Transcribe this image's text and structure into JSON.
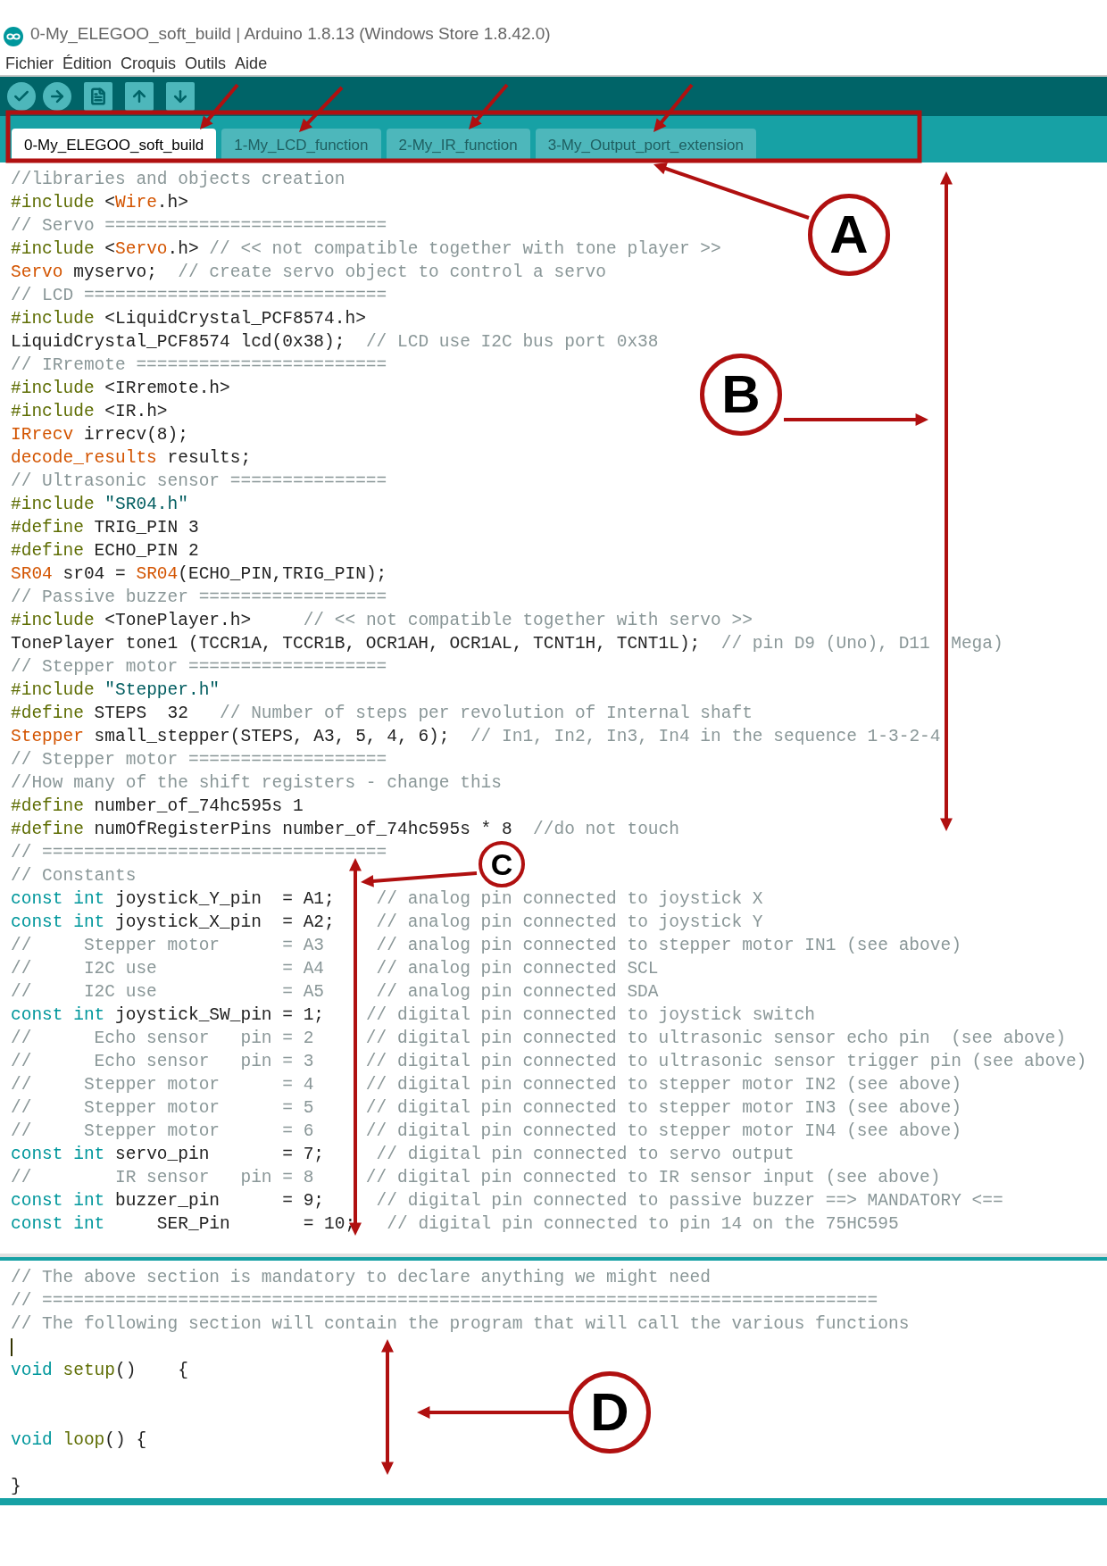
{
  "window": {
    "title": "0-My_ELEGOO_soft_build | Arduino 1.8.13 (Windows Store 1.8.42.0)"
  },
  "menu": [
    "Fichier",
    "Édition",
    "Croquis",
    "Outils",
    "Aide"
  ],
  "toolbar": [
    {
      "kind": "verify"
    },
    {
      "kind": "upload"
    },
    {
      "kind": "new"
    },
    {
      "kind": "open"
    },
    {
      "kind": "save"
    }
  ],
  "tabs": [
    {
      "label": "0-My_ELEGOO_soft_build",
      "selected": true
    },
    {
      "label": "1-My_LCD_function",
      "selected": false
    },
    {
      "label": "2-My_IR_function",
      "selected": false
    },
    {
      "label": "3-My_Output_port_extension",
      "selected": false
    }
  ],
  "editor": {
    "upper_lines": [
      {
        "segments": [
          {
            "kind": "comment",
            "text": "//libraries and objects creation"
          }
        ]
      },
      {
        "segments": [
          {
            "kind": "directive",
            "text": "#include"
          },
          {
            "kind": "plain",
            "text": " <"
          },
          {
            "kind": "type",
            "text": "Wire"
          },
          {
            "kind": "plain",
            "text": ".h>"
          }
        ]
      },
      {
        "segments": [
          {
            "kind": "comment",
            "text": "// Servo ==========================="
          }
        ]
      },
      {
        "segments": [
          {
            "kind": "directive",
            "text": "#include"
          },
          {
            "kind": "plain",
            "text": " <"
          },
          {
            "kind": "type",
            "text": "Servo"
          },
          {
            "kind": "plain",
            "text": ".h> "
          },
          {
            "kind": "comment",
            "text": "// << not compatible together with tone player >>"
          }
        ]
      },
      {
        "segments": [
          {
            "kind": "type",
            "text": "Servo"
          },
          {
            "kind": "plain",
            "text": " myservo;  "
          },
          {
            "kind": "comment",
            "text": "// create servo object to control a servo"
          }
        ]
      },
      {
        "segments": [
          {
            "kind": "comment",
            "text": "// LCD ============================="
          }
        ]
      },
      {
        "segments": [
          {
            "kind": "directive",
            "text": "#include"
          },
          {
            "kind": "plain",
            "text": " <LiquidCrystal_PCF8574.h>"
          }
        ]
      },
      {
        "segments": [
          {
            "kind": "plain",
            "text": "LiquidCrystal_PCF8574 lcd(0x38);  "
          },
          {
            "kind": "comment",
            "text": "// LCD use I2C bus port 0x38"
          }
        ]
      },
      {
        "segments": [
          {
            "kind": "comment",
            "text": "// IRremote ========================"
          }
        ]
      },
      {
        "segments": [
          {
            "kind": "directive",
            "text": "#include"
          },
          {
            "kind": "plain",
            "text": " <IRremote.h>"
          }
        ]
      },
      {
        "segments": [
          {
            "kind": "directive",
            "text": "#include"
          },
          {
            "kind": "plain",
            "text": " <IR.h>"
          }
        ]
      },
      {
        "segments": [
          {
            "kind": "type",
            "text": "IRrecv"
          },
          {
            "kind": "plain",
            "text": " irrecv(8);"
          }
        ]
      },
      {
        "segments": [
          {
            "kind": "type",
            "text": "decode_results"
          },
          {
            "kind": "plain",
            "text": " results;"
          }
        ]
      },
      {
        "segments": [
          {
            "kind": "comment",
            "text": "// Ultrasonic sensor ==============="
          }
        ]
      },
      {
        "segments": [
          {
            "kind": "directive",
            "text": "#include "
          },
          {
            "kind": "string",
            "text": "\"SR04.h\""
          }
        ]
      },
      {
        "segments": [
          {
            "kind": "directive",
            "text": "#define"
          },
          {
            "kind": "plain",
            "text": " TRIG_PIN 3"
          }
        ]
      },
      {
        "segments": [
          {
            "kind": "directive",
            "text": "#define"
          },
          {
            "kind": "plain",
            "text": " ECHO_PIN 2"
          }
        ]
      },
      {
        "segments": [
          {
            "kind": "type",
            "text": "SR04"
          },
          {
            "kind": "plain",
            "text": " sr04 = "
          },
          {
            "kind": "type",
            "text": "SR04"
          },
          {
            "kind": "plain",
            "text": "(ECHO_PIN,TRIG_PIN);"
          }
        ]
      },
      {
        "segments": [
          {
            "kind": "comment",
            "text": "// Passive buzzer =================="
          }
        ]
      },
      {
        "segments": [
          {
            "kind": "directive",
            "text": "#include"
          },
          {
            "kind": "plain",
            "text": " <TonePlayer.h>     "
          },
          {
            "kind": "comment",
            "text": "// << not compatible together with servo >>"
          }
        ]
      },
      {
        "segments": [
          {
            "kind": "plain",
            "text": "TonePlayer tone1 (TCCR1A, TCCR1B, OCR1AH, OCR1AL, TCNT1H, TCNT1L);  "
          },
          {
            "kind": "comment",
            "text": "// pin D9 (Uno), D11  Mega)"
          }
        ]
      },
      {
        "segments": [
          {
            "kind": "comment",
            "text": "// Stepper motor ==================="
          }
        ]
      },
      {
        "segments": [
          {
            "kind": "directive",
            "text": "#include "
          },
          {
            "kind": "string",
            "text": "\"Stepper.h\""
          }
        ]
      },
      {
        "segments": [
          {
            "kind": "directive",
            "text": "#define"
          },
          {
            "kind": "plain",
            "text": " STEPS  32   "
          },
          {
            "kind": "comment",
            "text": "// Number of steps per revolution of Internal shaft"
          }
        ]
      },
      {
        "segments": [
          {
            "kind": "type",
            "text": "Stepper"
          },
          {
            "kind": "plain",
            "text": " small_stepper(STEPS, A3, 5, 4, 6);  "
          },
          {
            "kind": "comment",
            "text": "// In1, In2, In3, In4 in the sequence 1-3-2-4"
          }
        ]
      },
      {
        "segments": [
          {
            "kind": "comment",
            "text": "// Stepper motor ==================="
          }
        ]
      },
      {
        "segments": [
          {
            "kind": "comment",
            "text": "//How many of the shift registers - change this"
          }
        ]
      },
      {
        "segments": [
          {
            "kind": "directive",
            "text": "#define"
          },
          {
            "kind": "plain",
            "text": " number_of_74hc595s 1"
          }
        ]
      },
      {
        "segments": [
          {
            "kind": "directive",
            "text": "#define"
          },
          {
            "kind": "plain",
            "text": " numOfRegisterPins number_of_74hc595s * 8  "
          },
          {
            "kind": "comment",
            "text": "//do not touch"
          }
        ]
      },
      {
        "segments": [
          {
            "kind": "comment",
            "text": "// ================================="
          }
        ]
      },
      {
        "segments": [
          {
            "kind": "comment",
            "text": "// Constants"
          }
        ]
      },
      {
        "segments": [
          {
            "kind": "keyword",
            "text": "const int"
          },
          {
            "kind": "plain",
            "text": " joystick_Y_pin  = A1;    "
          },
          {
            "kind": "comment",
            "text": "// analog pin connected to joystick X"
          }
        ]
      },
      {
        "segments": [
          {
            "kind": "keyword",
            "text": "const int"
          },
          {
            "kind": "plain",
            "text": " joystick_X_pin  = A2;    "
          },
          {
            "kind": "comment",
            "text": "// analog pin connected to joystick Y"
          }
        ]
      },
      {
        "segments": [
          {
            "kind": "comment",
            "text": "//     Stepper motor      = A3     // analog pin connected to stepper motor IN1 (see above)"
          }
        ]
      },
      {
        "segments": [
          {
            "kind": "comment",
            "text": "//     I2C use            = A4     // analog pin connected SCL"
          }
        ]
      },
      {
        "segments": [
          {
            "kind": "comment",
            "text": "//     I2C use            = A5     // analog pin connected SDA"
          }
        ]
      },
      {
        "segments": [
          {
            "kind": "keyword",
            "text": "const int"
          },
          {
            "kind": "plain",
            "text": " joystick_SW_pin = 1;    "
          },
          {
            "kind": "comment",
            "text": "// digital pin connected to joystick switch"
          }
        ]
      },
      {
        "segments": [
          {
            "kind": "comment",
            "text": "//      Echo sensor   pin = 2     // digital pin connected to ultrasonic sensor echo pin  (see above)"
          }
        ]
      },
      {
        "segments": [
          {
            "kind": "comment",
            "text": "//      Echo sensor   pin = 3     // digital pin connected to ultrasonic sensor trigger pin (see above)"
          }
        ]
      },
      {
        "segments": [
          {
            "kind": "comment",
            "text": "//     Stepper motor      = 4     // digital pin connected to stepper motor IN2 (see above)"
          }
        ]
      },
      {
        "segments": [
          {
            "kind": "comment",
            "text": "//     Stepper motor      = 5     // digital pin connected to stepper motor IN3 (see above)"
          }
        ]
      },
      {
        "segments": [
          {
            "kind": "comment",
            "text": "//     Stepper motor      = 6     // digital pin connected to stepper motor IN4 (see above)"
          }
        ]
      },
      {
        "segments": [
          {
            "kind": "keyword",
            "text": "const int"
          },
          {
            "kind": "plain",
            "text": " servo_pin       = 7;     "
          },
          {
            "kind": "comment",
            "text": "// digital pin connected to servo output"
          }
        ]
      },
      {
        "segments": [
          {
            "kind": "comment",
            "text": "//        IR sensor   pin = 8     // digital pin connected to IR sensor input (see above)"
          }
        ]
      },
      {
        "segments": [
          {
            "kind": "keyword",
            "text": "const int"
          },
          {
            "kind": "plain",
            "text": " buzzer_pin      = 9;     "
          },
          {
            "kind": "comment",
            "text": "// digital pin connected to passive buzzer ==> MANDATORY <=="
          }
        ]
      },
      {
        "segments": [
          {
            "kind": "keyword",
            "text": "const int"
          },
          {
            "kind": "plain",
            "text": "     SER_Pin       = 10;   "
          },
          {
            "kind": "comment",
            "text": "// digital pin connected to pin 14 on the 75HC595"
          }
        ]
      }
    ],
    "lower_lines": [
      {
        "caret": false,
        "segments": [
          {
            "kind": "comment",
            "text": "// The above section is mandatory to declare anything we might need"
          }
        ]
      },
      {
        "caret": false,
        "segments": [
          {
            "kind": "comment",
            "text": "// ================================================================================"
          }
        ]
      },
      {
        "caret": false,
        "segments": [
          {
            "kind": "comment",
            "text": "// The following section will contain the program that will call the various functions"
          }
        ]
      },
      {
        "caret": true
      },
      {
        "caret": false,
        "segments": [
          {
            "kind": "keyword",
            "text": "void "
          },
          {
            "kind": "func",
            "text": "setup"
          },
          {
            "kind": "plain",
            "text": "()    {"
          }
        ]
      },
      {
        "caret": false
      },
      {
        "caret": false
      },
      {
        "caret": false,
        "segments": [
          {
            "kind": "keyword",
            "text": "void "
          },
          {
            "kind": "func",
            "text": "loop"
          },
          {
            "kind": "plain",
            "text": "() {"
          }
        ]
      },
      {
        "caret": false
      },
      {
        "caret": false,
        "segments": [
          {
            "kind": "plain",
            "text": "}"
          }
        ]
      }
    ]
  },
  "annotations": [
    {
      "label": "A"
    },
    {
      "label": "B"
    },
    {
      "label": "C"
    },
    {
      "label": "D"
    }
  ]
}
